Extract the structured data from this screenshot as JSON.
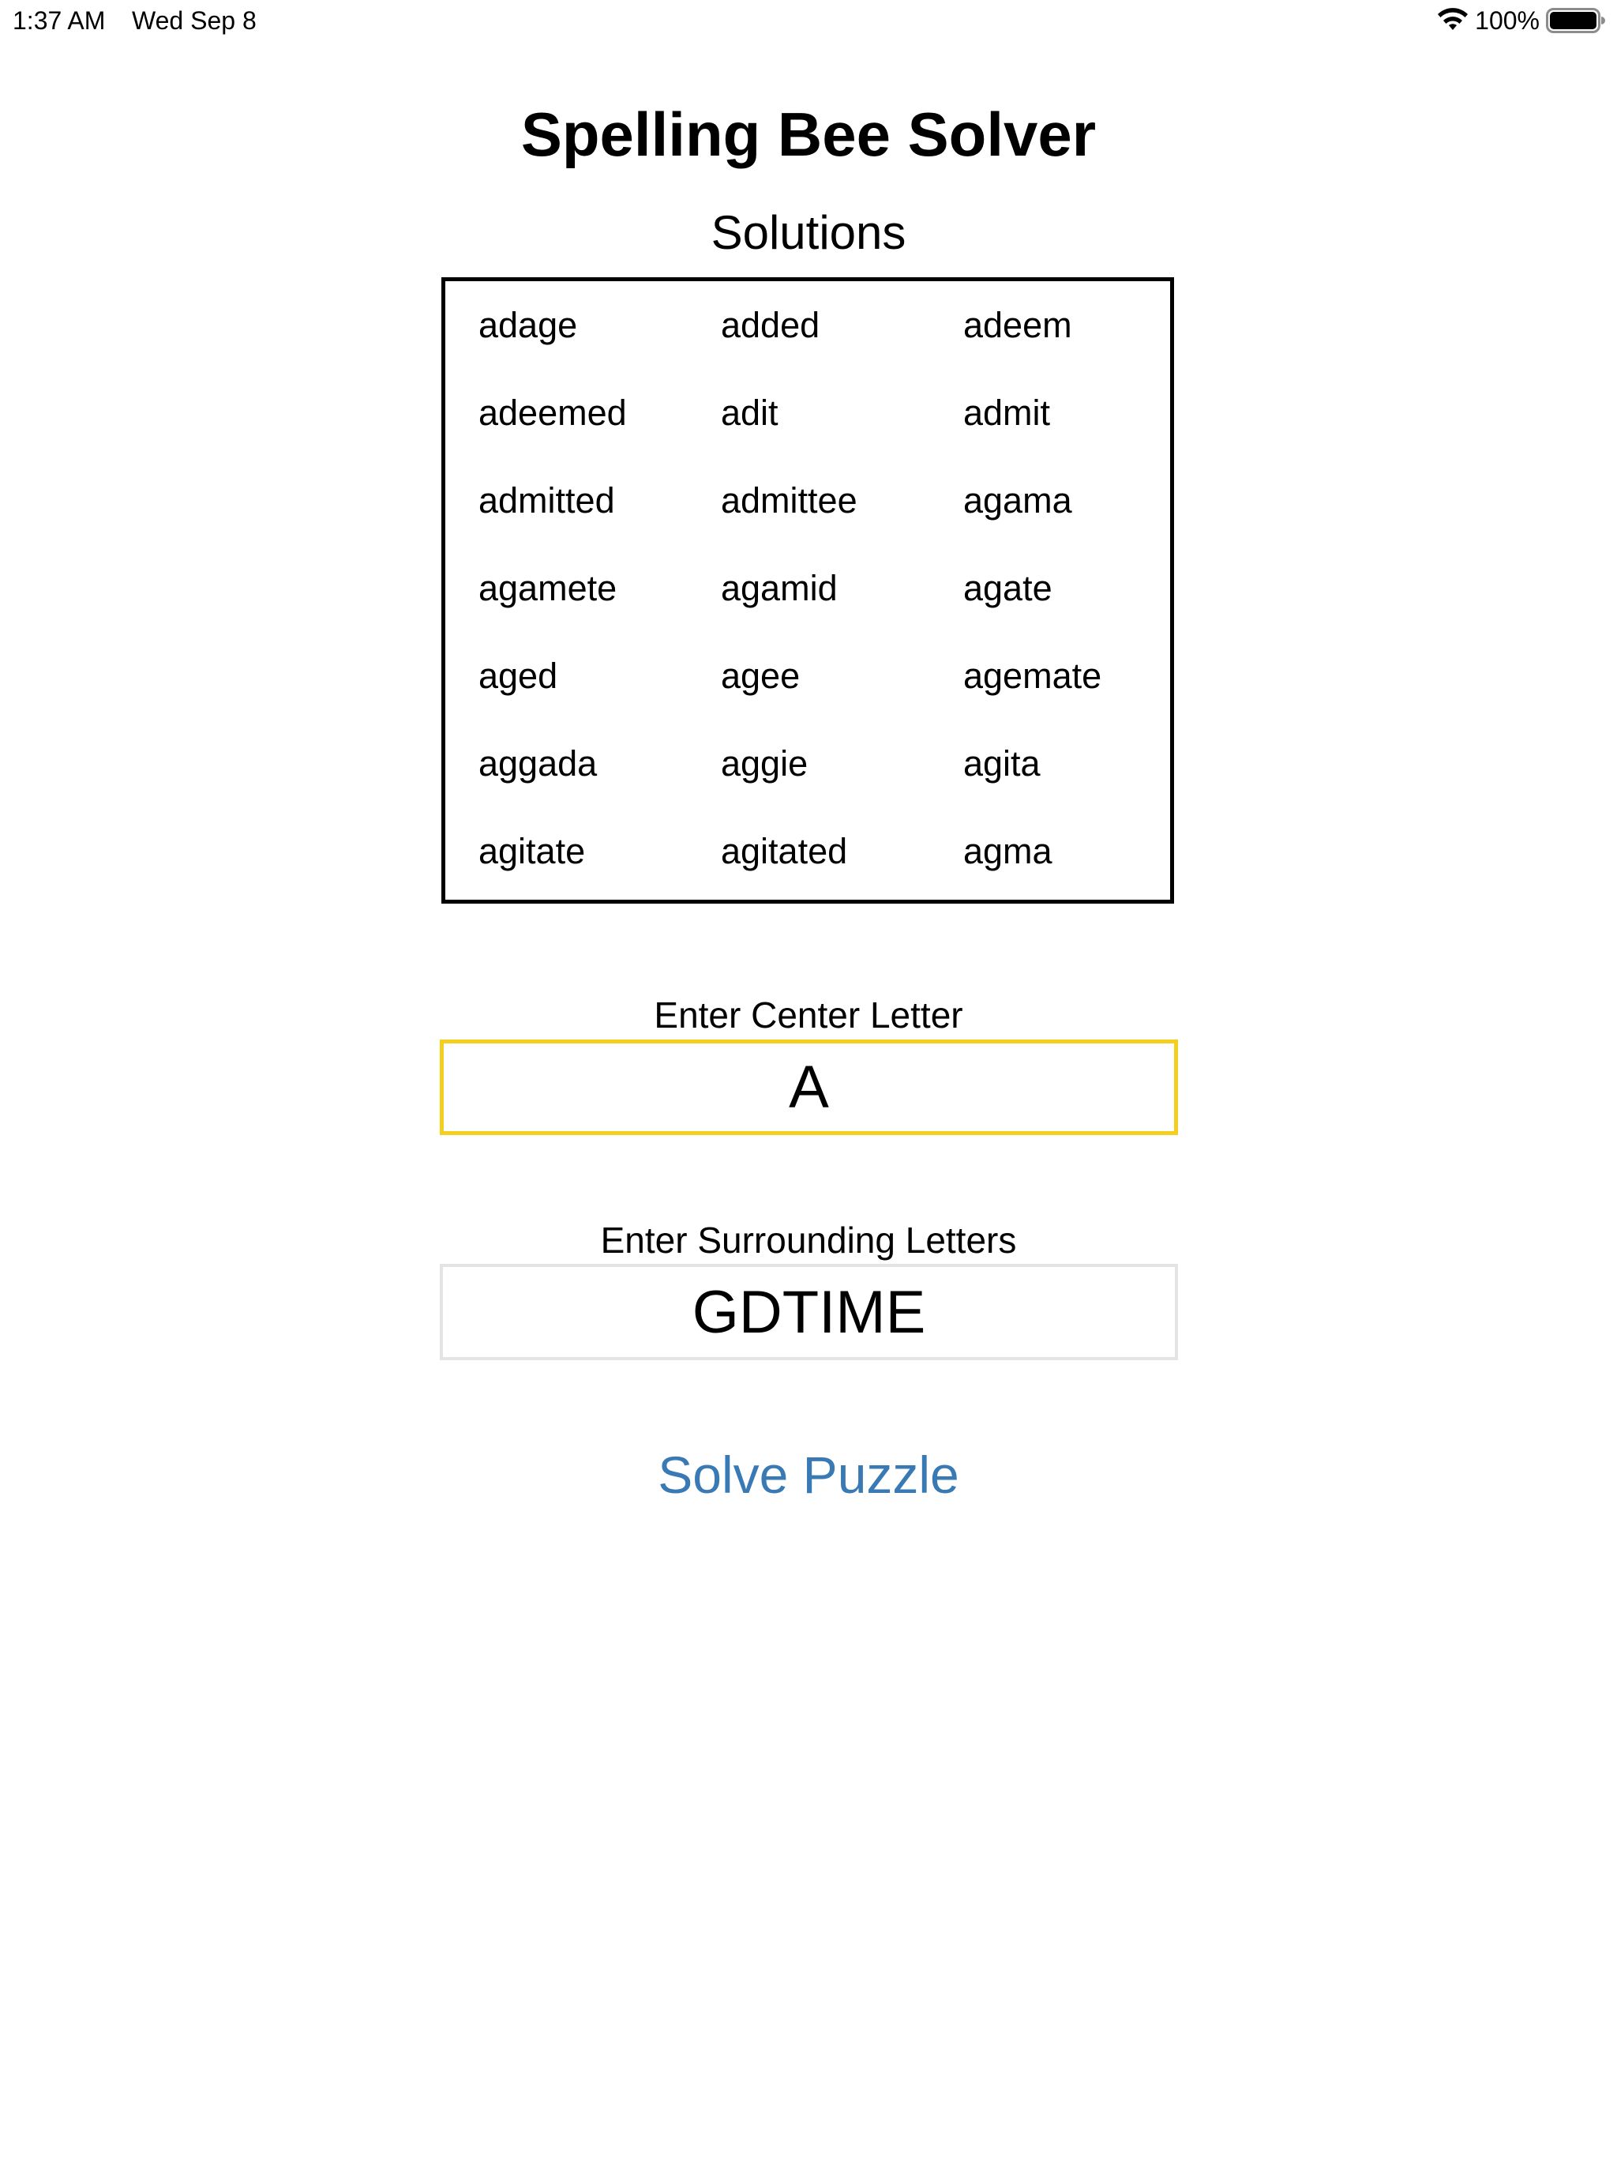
{
  "status_bar": {
    "time": "1:37 AM",
    "date": "Wed Sep 8",
    "battery_percent": "100%",
    "battery_level": 1.0,
    "icons": [
      "wifi-icon",
      "battery-icon"
    ]
  },
  "title": "Spelling Bee Solver",
  "solutions": {
    "heading": "Solutions",
    "words": [
      "adage",
      "added",
      "adeem",
      "adeemed",
      "adit",
      "admit",
      "admitted",
      "admittee",
      "agama",
      "agamete",
      "agamid",
      "agate",
      "aged",
      "agee",
      "agemate",
      "aggada",
      "aggie",
      "agita",
      "agitate",
      "agitated",
      "agma"
    ]
  },
  "center_letter": {
    "label": "Enter Center Letter",
    "value": "A"
  },
  "surrounding_letters": {
    "label": "Enter Surrounding Letters",
    "value": "GDTIME"
  },
  "solve_button": {
    "label": "Solve Puzzle"
  },
  "colors": {
    "accent_blue": "#3a7ab4",
    "focus_yellow": "#f4cf1f",
    "field_border_gray": "#e4e4e4"
  }
}
